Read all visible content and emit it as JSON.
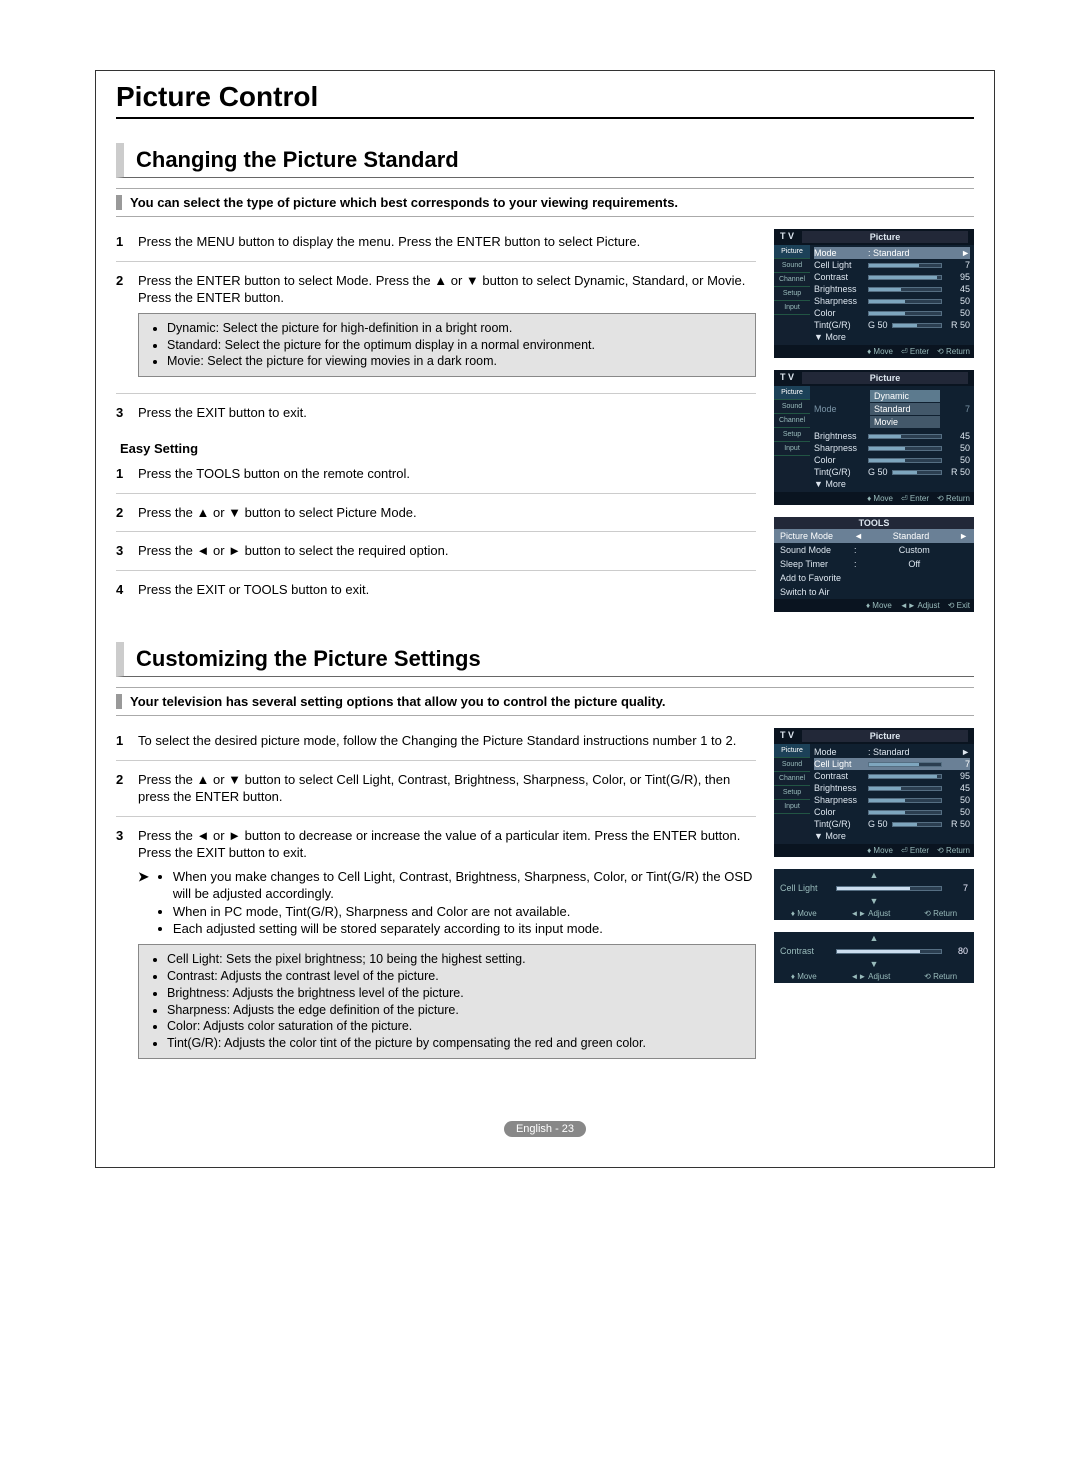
{
  "page": {
    "title": "Picture Control",
    "footer": "English - 23"
  },
  "section_a": {
    "heading": "Changing the Picture Standard",
    "intro": "You can select the type of picture which best corresponds to your viewing requirements.",
    "steps": [
      "Press the MENU button to display the menu.\nPress the ENTER button to select Picture.",
      "Press the ENTER button to select Mode.\nPress the ▲ or ▼ button to select Dynamic, Standard, or Movie.\nPress the ENTER button.",
      "Press the EXIT button to exit."
    ],
    "note_box": [
      "Dynamic: Select the picture for high-definition in a bright room.",
      "Standard: Select the picture for the optimum display in a normal environment.",
      "Movie: Select the picture for viewing movies in a dark room."
    ],
    "easy_heading": "Easy Setting",
    "easy_steps": [
      "Press the TOOLS button on the remote control.",
      "Press the ▲ or ▼ button to select Picture Mode.",
      "Press the ◄ or ► button to select the required option.",
      "Press the EXIT or TOOLS button to exit."
    ]
  },
  "section_b": {
    "heading": "Customizing the Picture Settings",
    "intro": "Your television has several setting options that allow you to control the picture quality.",
    "steps": [
      "To select the desired picture mode, follow the Changing the Picture Standard instructions number 1 to 2.",
      "Press the ▲ or ▼ button to select Cell Light, Contrast, Brightness, Sharpness, Color, or Tint(G/R), then press the ENTER button.",
      "Press the ◄ or ► button to decrease or increase the value of a particular item. Press the ENTER button.\nPress the EXIT button to exit."
    ],
    "arrow_bullets": [
      "When you make changes to Cell Light, Contrast, Brightness, Sharpness, Color, or Tint(G/R) the OSD will be adjusted accordingly.",
      "When in PC mode, Tint(G/R), Sharpness and Color are not available.",
      "Each adjusted setting will be stored separately according to its input mode."
    ],
    "def_box": [
      "Cell Light: Sets the pixel brightness; 10 being the highest setting.",
      "Contrast: Adjusts the contrast level of the picture.",
      "Brightness: Adjusts the brightness level of the picture.",
      "Sharpness: Adjusts the edge definition of the picture.",
      "Color: Adjusts color saturation of the picture.",
      "Tint(G/R): Adjusts the color tint of the picture by compensating the red and green color."
    ]
  },
  "osd": {
    "tv_label": "T V",
    "panel_title": "Picture",
    "side_items": [
      "Picture",
      "Sound",
      "Channel",
      "Setup",
      "Input"
    ],
    "pic_rows": [
      {
        "label": "Mode",
        "value_text": ": Standard",
        "arrow": "►"
      },
      {
        "label": "Cell Light",
        "value": "7",
        "fill": 70
      },
      {
        "label": "Contrast",
        "value": "95",
        "fill": 95
      },
      {
        "label": "Brightness",
        "value": "45",
        "fill": 45
      },
      {
        "label": "Sharpness",
        "value": "50",
        "fill": 50
      },
      {
        "label": "Color",
        "value": "50",
        "fill": 50
      },
      {
        "label": "Tint(G/R)",
        "prefix": "G 50",
        "value": "R 50",
        "fill": 50
      },
      {
        "label": "▼ More"
      }
    ],
    "dropdown_options": [
      "Dynamic",
      "Standard",
      "Movie"
    ],
    "foot": {
      "move": "Move",
      "enter": "Enter",
      "return": "Return",
      "adjust": "Adjust",
      "exit": "Exit"
    },
    "tools": {
      "title": "TOOLS",
      "rows": [
        {
          "label": "Picture Mode",
          "sep": "◄",
          "value": "Standard",
          "arrow": "►"
        },
        {
          "label": "Sound Mode",
          "sep": ":",
          "value": "Custom"
        },
        {
          "label": "Sleep Timer",
          "sep": ":",
          "value": "Off"
        },
        {
          "label": "Add to Favorite"
        },
        {
          "label": "Switch to Air"
        }
      ]
    },
    "slim_cell": {
      "label": "Cell Light",
      "value": "7",
      "fill": 70
    },
    "slim_contrast": {
      "label": "Contrast",
      "value": "80",
      "fill": 80
    }
  }
}
